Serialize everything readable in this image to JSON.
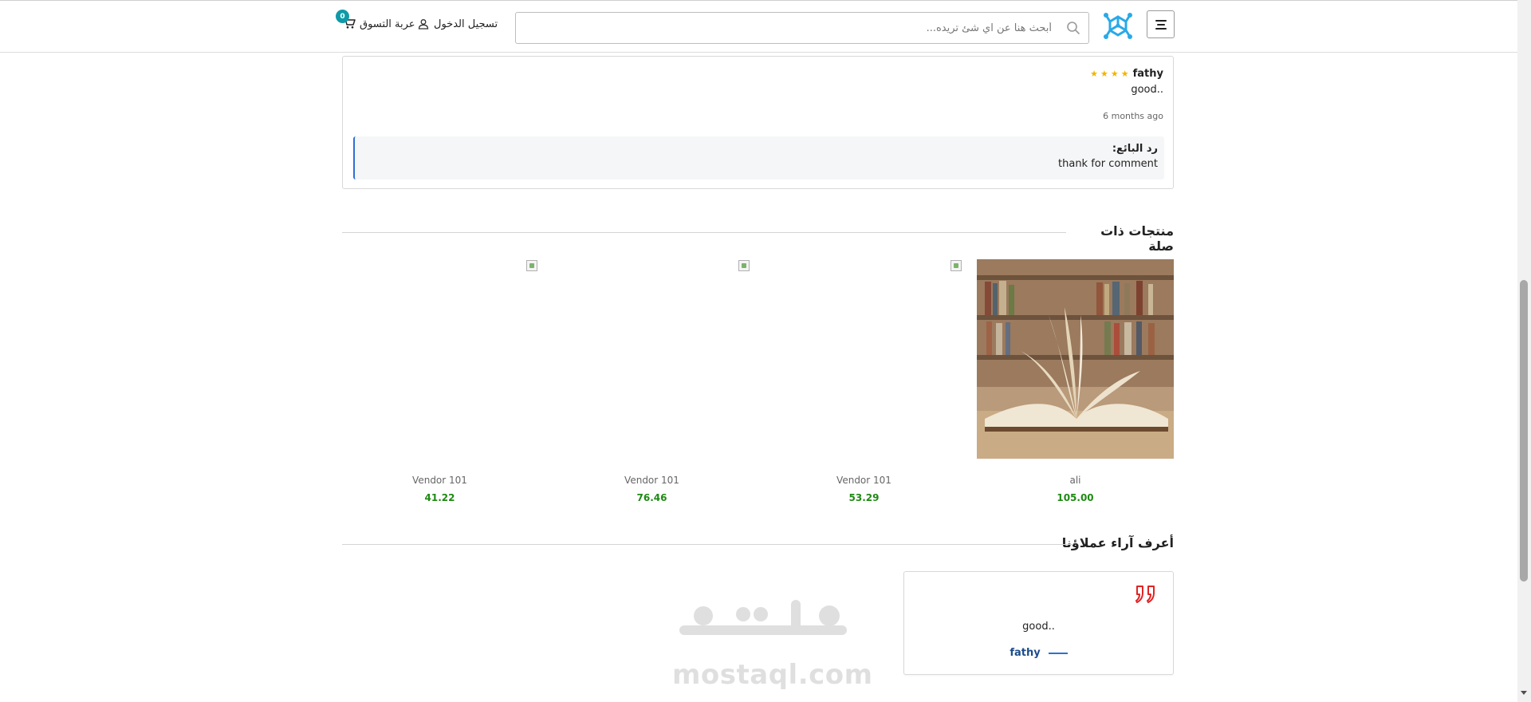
{
  "header": {
    "search_placeholder": "أبحث هنا عن اي شئ تريده...",
    "login_label": "تسجيل الدخول",
    "cart_label": "عربة التسوق",
    "cart_count": "0",
    "brand_color": "#29a9e8"
  },
  "review": {
    "name": "fathy",
    "rating": 4,
    "text": "good..",
    "date": "6 months ago",
    "reply_label": "رد البائع:",
    "reply_text": "thank for comment"
  },
  "related": {
    "title": "منتجات ذات صلة",
    "products": [
      {
        "vendor": "ali",
        "price": "105.00",
        "image": "open-book-photo"
      },
      {
        "vendor": "Vendor 101",
        "price": "53.29",
        "image": "broken-image"
      },
      {
        "vendor": "Vendor 101",
        "price": "76.46",
        "image": "broken-image"
      },
      {
        "vendor": "Vendor 101",
        "price": "41.22",
        "image": "broken-image"
      }
    ]
  },
  "testimonials": {
    "title": "أعرف آراء عملاؤنا",
    "items": [
      {
        "text": "good..",
        "author": "fathy"
      }
    ]
  },
  "watermark": {
    "text": "mostaql.com"
  },
  "colors": {
    "price": "#1f8a13",
    "star": "#f1b500",
    "accent_blue": "#2d6fd6",
    "quote_red": "#e02424",
    "badge": "#0f9aa8"
  }
}
